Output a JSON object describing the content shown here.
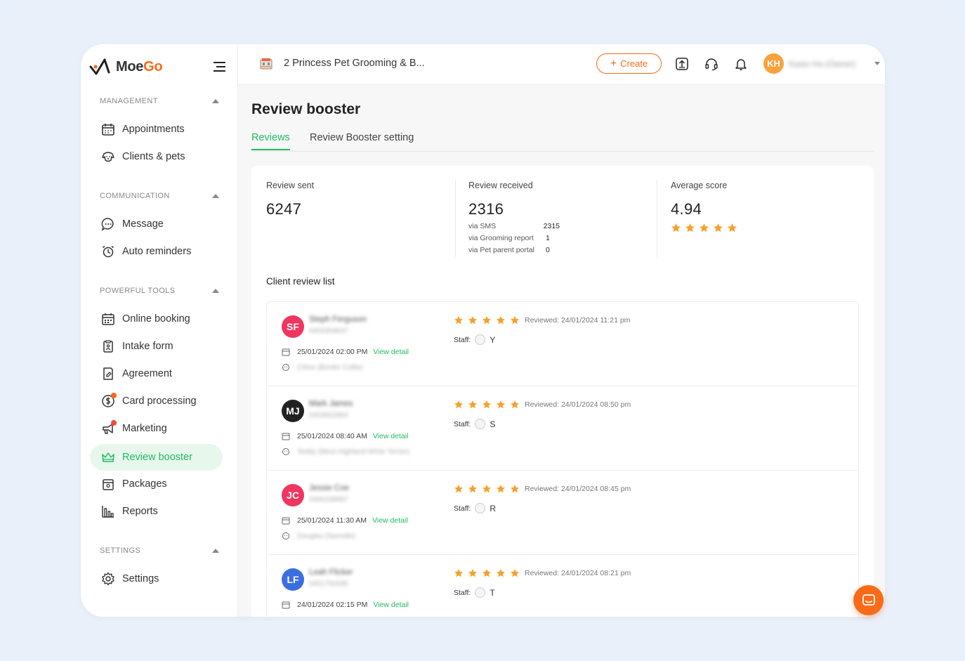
{
  "app": {
    "brand_prefix": "Moe",
    "brand_suffix": "Go"
  },
  "sidebar": {
    "sections": [
      {
        "title": "MANAGEMENT",
        "items": [
          "Appointments",
          "Clients & pets"
        ]
      },
      {
        "title": "COMMUNICATION",
        "items": [
          "Message",
          "Auto reminders"
        ]
      },
      {
        "title": "POWERFUL TOOLS",
        "items": [
          "Online booking",
          "Intake form",
          "Agreement",
          "Card processing",
          "Marketing",
          "Review booster",
          "Packages",
          "Reports"
        ]
      },
      {
        "title": "SETTINGS",
        "items": [
          "Settings"
        ]
      }
    ],
    "active_item": "Review booster"
  },
  "topbar": {
    "business_name": "2 Princess Pet Grooming & B...",
    "create_label": "Create",
    "user_initials": "KH",
    "user_name": "Kasio Ha (Owner)"
  },
  "page": {
    "title": "Review booster",
    "tabs": [
      "Reviews",
      "Review Booster setting"
    ],
    "active_tab": "Reviews"
  },
  "stats": {
    "sent_label": "Review sent",
    "sent_value": "6247",
    "received_label": "Review received",
    "received_value": "2316",
    "breakdown": [
      {
        "label": "via SMS",
        "value": "2315"
      },
      {
        "label": "via Grooming report",
        "value": "1"
      },
      {
        "label": "via Pet parent portal",
        "value": "0"
      }
    ],
    "avg_label": "Average score",
    "avg_value": "4.94",
    "avg_stars": 5
  },
  "list": {
    "title": "Client review list",
    "view_detail_label": "View detail",
    "staff_label": "Staff:",
    "reviews": [
      {
        "initials": "SF",
        "avatar_color": "#f0355e",
        "name": "Steph Ferguson",
        "phone": "0403358647",
        "appt": "25/01/2024 02:00 PM",
        "pet": "Chloe (Border Collie)",
        "stars": 5,
        "reviewed": "Reviewed: 24/01/2024 11:21 pm",
        "staff": "Y"
      },
      {
        "initials": "MJ",
        "avatar_color": "#222222",
        "name": "Mark James",
        "phone": "0403922964",
        "appt": "25/01/2024 08:40 AM",
        "pet": "Teddy (West Highland White Terrier)",
        "stars": 5,
        "reviewed": "Reviewed: 24/01/2024 08:50 pm",
        "staff": "S"
      },
      {
        "initials": "JC",
        "avatar_color": "#f0355e",
        "name": "Jessie Coe",
        "phone": "0466338887",
        "appt": "25/01/2024 11:30 AM",
        "pet": "Douglas (Spoodle)",
        "stars": 5,
        "reviewed": "Reviewed: 24/01/2024 08:45 pm",
        "staff": "R"
      },
      {
        "initials": "LF",
        "avatar_color": "#3b6fe0",
        "name": "Leah Flicker",
        "phone": "0401750335",
        "appt": "24/01/2024 02:15 PM",
        "pet": "",
        "stars": 5,
        "reviewed": "Reviewed: 24/01/2024 08:21 pm",
        "staff": "T"
      }
    ]
  },
  "colors": {
    "accent_green": "#1fbb5f",
    "brand_orange": "#f96b18",
    "star": "#f7a02a"
  }
}
